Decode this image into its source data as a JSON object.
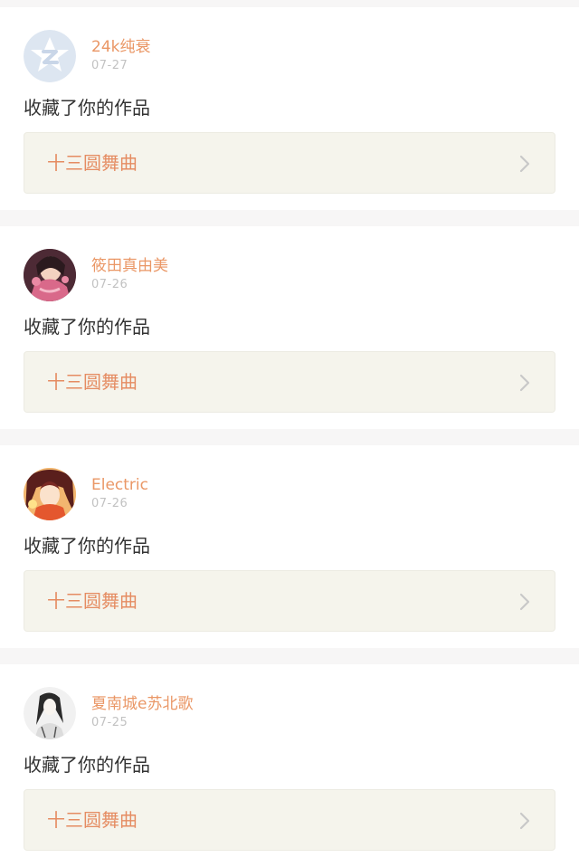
{
  "notifications": [
    {
      "username": "24k纯衰",
      "date": "07-27",
      "action": "收藏了你的作品",
      "work_title": "十三圆舞曲",
      "avatar_icon": "default-avatar-icon"
    },
    {
      "username": "筱田真由美",
      "date": "07-26",
      "action": "收藏了你的作品",
      "work_title": "十三圆舞曲",
      "avatar_icon": "user-avatar-icon"
    },
    {
      "username": "Electric",
      "date": "07-26",
      "action": "收藏了你的作品",
      "work_title": "十三圆舞曲",
      "avatar_icon": "user-avatar-icon"
    },
    {
      "username": "夏南城e苏北歌",
      "date": "07-25",
      "action": "收藏了你的作品",
      "work_title": "十三圆舞曲",
      "avatar_icon": "user-avatar-icon"
    }
  ],
  "colors": {
    "username": "#ea9766",
    "work_title": "#e58c62",
    "work_card_bg": "#f5f4ec",
    "date": "#c2c2c2",
    "action": "#333333",
    "page_bg": "#f7f6f6"
  }
}
